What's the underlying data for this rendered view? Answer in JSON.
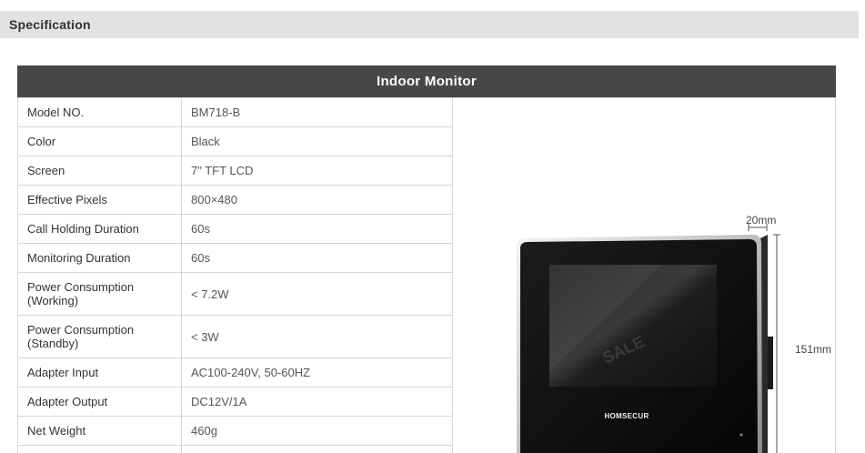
{
  "section": {
    "title": "Specification"
  },
  "product": {
    "title": "Indoor Monitor"
  },
  "specs": [
    {
      "label": "Model NO.",
      "value": "BM718-B"
    },
    {
      "label": "Color",
      "value": "Black"
    },
    {
      "label": "Screen",
      "value": "7\" TFT LCD"
    },
    {
      "label": "Effective Pixels",
      "value": "800×480"
    },
    {
      "label": "Call Holding Duration",
      "value": "60s"
    },
    {
      "label": "Monitoring Duration",
      "value": "60s"
    },
    {
      "label": "Power Consumption (Working)",
      "value": "< 7.2W"
    },
    {
      "label": "Power Consumption (Standby)",
      "value": "< 3W"
    },
    {
      "label": "Adapter Input",
      "value": "AC100-240V, 50-60HZ"
    },
    {
      "label": "Adapter Output",
      "value": "DC12V/1A"
    },
    {
      "label": "Net Weight",
      "value": "460g"
    },
    {
      "label": "",
      "value": ""
    }
  ],
  "image": {
    "brand": "HOMSECUR",
    "depth_label": "20mm",
    "height_label": "151mm",
    "watermark": "SALE"
  }
}
